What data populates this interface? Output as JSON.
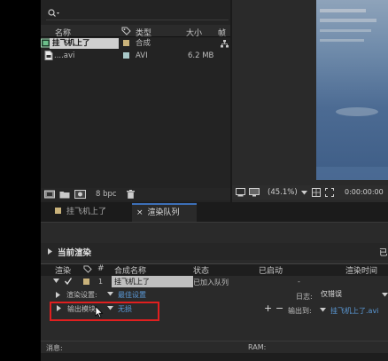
{
  "project": {
    "search_placeholder": "",
    "columns": {
      "name": "名称",
      "type": "类型",
      "size": "大小",
      "fps": "帧"
    },
    "items": [
      {
        "name": "挂飞机上了",
        "type": "合成",
        "size": ""
      },
      {
        "name": "....avi",
        "type": "AVI",
        "size": "6.2 MB"
      }
    ],
    "bpc": "8 bpc"
  },
  "viewer": {
    "zoom": "(45.1%)",
    "timecode": "0:00:00:00"
  },
  "tabs": [
    {
      "label": "挂飞机上了"
    },
    {
      "label": "渲染队列"
    }
  ],
  "render_queue": {
    "current_render": "当前渲染",
    "current_render_right": "已",
    "headers": {
      "render": "渲染",
      "num": "#",
      "comp_name": "合成名称",
      "status": "状态",
      "started": "已启动",
      "render_time": "渲染时间"
    },
    "row": {
      "num": "1",
      "name": "挂飞机上了",
      "status": "已加入队列",
      "started": "-"
    },
    "render_settings_label": "渲染设置:",
    "render_settings_value": "最佳设置",
    "log_label": "日志:",
    "log_value": "仅错误",
    "output_module_label": "输出模块:",
    "output_module_value": "无损",
    "output_to_label": "输出到:",
    "output_to_value": "挂飞机上了.avi",
    "message_label": "消息:",
    "ram_label": "RAM:"
  },
  "colors": {
    "accent": "#3c6fb7",
    "link": "#5b9ad8",
    "highlight": "#e01f1f",
    "comp_label": "#c9b27a",
    "avi_label": "#a9c8c8"
  }
}
